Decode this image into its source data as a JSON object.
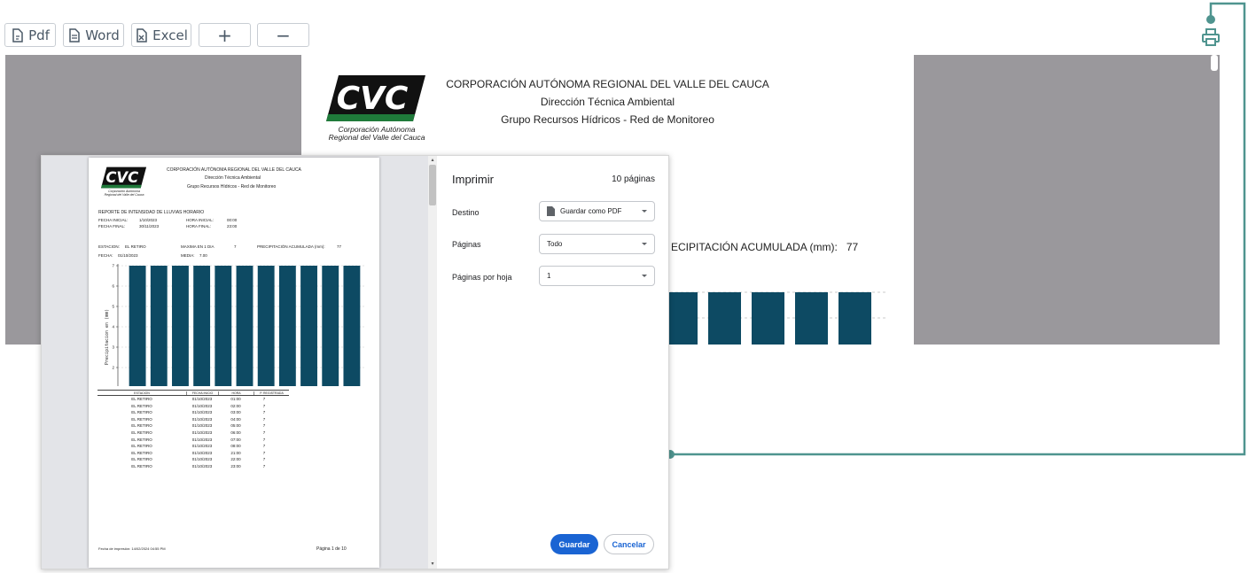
{
  "toolbar": {
    "pdf_label": "Pdf",
    "word_label": "Word",
    "excel_label": "Excel",
    "zoom_in_label": "+",
    "zoom_out_label": "−"
  },
  "report": {
    "logo_text": "CVC",
    "logo_sub_1": "Corporación Autónoma",
    "logo_sub_2": "Regional del Valle del Cauca",
    "org_title": "CORPORACIÓN AUTÓNOMA  REGIONAL DEL VALLE DEL CAUCA",
    "direction": "Dirección Técnica Ambiental",
    "group": "Grupo Recursos Hídricos - Red de Monitoreo",
    "accum_label": "ECIPITACIÓN ACUMULADA (mm):",
    "accum_value": "77",
    "report_title": "REPORTE DE INTENSIDAD DE LLUVIAS HORARIO",
    "fecha_inicial_label": "FECHA INICIAL:",
    "fecha_inicial": "1/10/2023",
    "fecha_final_label": "FECHA FINAL:",
    "fecha_final": "30/11/2023",
    "hora_inicial_label": "HORA INICIAL:",
    "hora_inicial": "00:00",
    "hora_final_label": "HORA FINAL:",
    "hora_final": "23:00",
    "estacion_label": "ESTACION:",
    "estacion": "EL RETIRO",
    "maxima_label": "MAXIMA EN 1 DIA",
    "maxima": "7",
    "precip_label": "PRECIPITACIÓN ACUMULADA (mm):",
    "precip": "77",
    "fecha_label": "FECHA:",
    "fecha": "01/10/2023",
    "media_label": "MEDIA:",
    "media": "7.00",
    "table_headers": [
      "ESTACION",
      "FECHA INICIO",
      "HORA",
      "P. REGISTRADA"
    ],
    "table_rows": [
      [
        "EL RETIRO",
        "01/10/2023",
        "01:00",
        "7"
      ],
      [
        "EL RETIRO",
        "01/10/2023",
        "02:00",
        "7"
      ],
      [
        "EL RETIRO",
        "01/10/2023",
        "03:00",
        "7"
      ],
      [
        "EL RETIRO",
        "01/10/2023",
        "04:00",
        "7"
      ],
      [
        "EL RETIRO",
        "01/10/2023",
        "05:00",
        "7"
      ],
      [
        "EL RETIRO",
        "01/10/2023",
        "06:00",
        "7"
      ],
      [
        "EL RETIRO",
        "01/10/2023",
        "07:00",
        "7"
      ],
      [
        "EL RETIRO",
        "01/10/2023",
        "08:00",
        "7"
      ],
      [
        "EL RETIRO",
        "01/10/2023",
        "21:00",
        "7"
      ],
      [
        "EL RETIRO",
        "01/10/2023",
        "22:00",
        "7"
      ],
      [
        "EL RETIRO",
        "01/10/2023",
        "23:00",
        "7"
      ]
    ],
    "footer_date": "Fecha de impresión:  14/02/2024 04:55 PM",
    "footer_page": "Página 1 de 10"
  },
  "print_dialog": {
    "title": "Imprimir",
    "pages_count": "10 páginas",
    "destino_label": "Destino",
    "destino_value": "Guardar como PDF",
    "paginas_label": "Páginas",
    "paginas_value": "Todo",
    "por_hoja_label": "Páginas por hoja",
    "por_hoja_value": "1",
    "save_label": "Guardar",
    "cancel_label": "Cancelar"
  },
  "colors": {
    "bar": "#0d4a63",
    "accent": "#4f948f",
    "primary_button": "#1a64d3"
  },
  "chart_data": {
    "type": "bar",
    "categories": [
      "01",
      "02",
      "03",
      "04",
      "05",
      "06",
      "07",
      "08",
      "21",
      "22",
      "23"
    ],
    "series": [
      {
        "name": "EL RETIRO",
        "values": [
          7,
          7,
          7,
          7,
          7,
          7,
          7,
          7,
          7,
          7,
          7
        ]
      }
    ],
    "xlabel": "Tiempo Dias - Horas",
    "ylabel": "Precipitacion en (mm)",
    "ylim": [
      0,
      7
    ],
    "yticks": [
      "0",
      "1",
      "2",
      "3",
      "4",
      "5",
      "6",
      "7"
    ],
    "grid": true,
    "legend": "bottom"
  }
}
